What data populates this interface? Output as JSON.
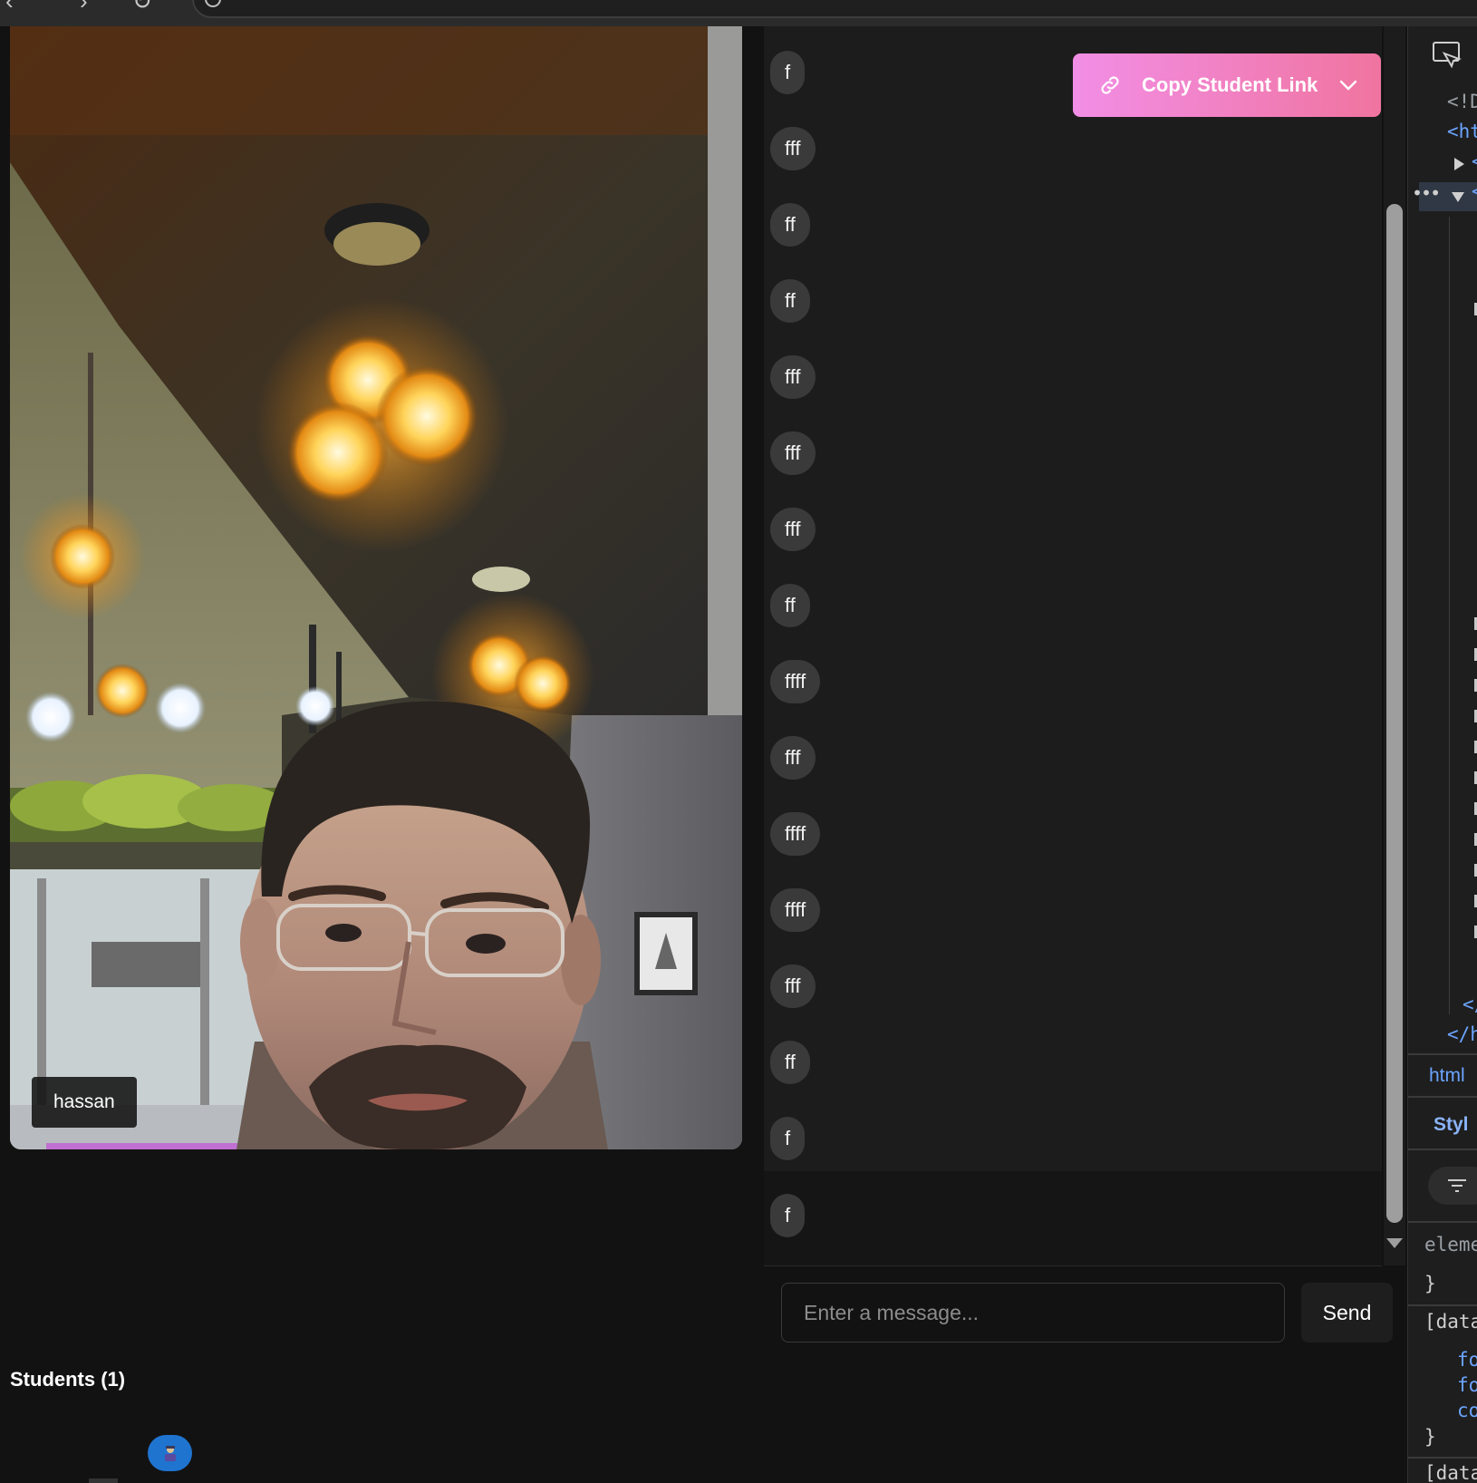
{
  "video": {
    "participant_name": "hassan"
  },
  "chat": {
    "copy_button_label": "Copy Student Link",
    "messages": [
      "f",
      "fff",
      "ff",
      "ff",
      "fff",
      "fff",
      "fff",
      "ff",
      "ffff",
      "fff",
      "ffff",
      "ffff",
      "fff",
      "ff",
      "f",
      "f"
    ],
    "input_placeholder": "Enter a message...",
    "send_label": "Send"
  },
  "students": {
    "title": "Students (1)"
  },
  "devtools": {
    "code_fragments": [
      "<!D",
      "<ht",
      "<",
      "<",
      "</h"
    ],
    "breadcrumb": "html",
    "styles_tab": "Styl",
    "style_lines": [
      "eleme",
      "}",
      "[data",
      "fo",
      "fo",
      "co",
      "}",
      "[data"
    ]
  },
  "colors": {
    "page_bg": "#121212",
    "chat_bg": "#1c1c1c",
    "bubble_bg": "#3a3a3a",
    "copy_gradient_start": "#f28ee6",
    "copy_gradient_end": "#f0749f",
    "avatar_blue": "#1f74d0",
    "devtools_tag_blue": "#6ba4ff"
  },
  "icons": [
    "back-arrow-icon",
    "forward-arrow-icon",
    "reload-icon",
    "site-info-icon",
    "link-icon",
    "chevron-down-icon",
    "scroll-down-arrow-icon",
    "student-avatar-icon",
    "cast-icon",
    "expand-triangle-icon",
    "filter-icon"
  ]
}
